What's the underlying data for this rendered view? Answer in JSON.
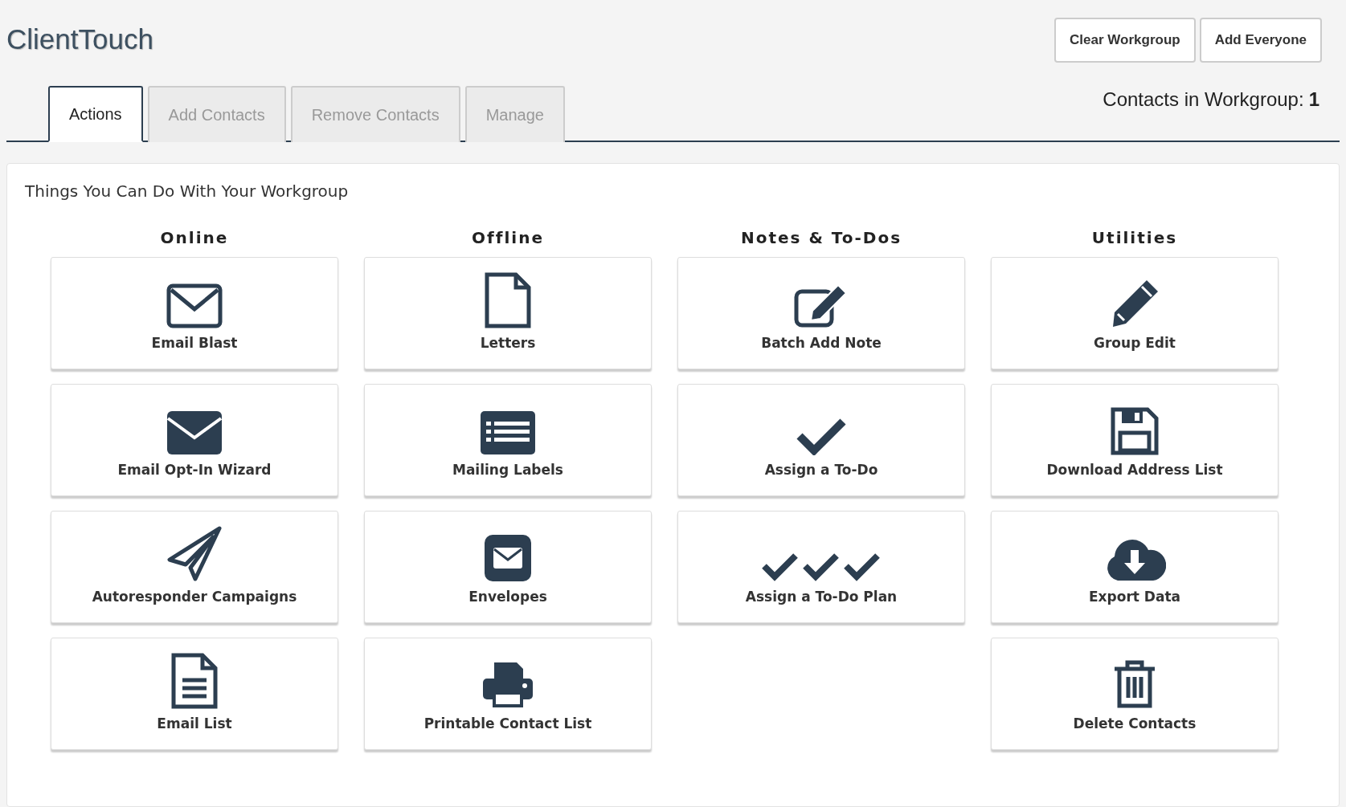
{
  "title": "ClientTouch",
  "header_buttons": [
    "Clear Workgroup",
    "Add Everyone"
  ],
  "tabs": [
    {
      "label": "Actions",
      "selected": true
    },
    {
      "label": "Add Contacts",
      "selected": false
    },
    {
      "label": "Remove Contacts",
      "selected": false
    },
    {
      "label": "Manage",
      "selected": false
    }
  ],
  "workgroup_count": {
    "label": "Contacts in Workgroup:",
    "value": "1"
  },
  "panel": {
    "heading": "Things You Can Do With Your Workgroup",
    "columns": [
      {
        "title": "Online",
        "actions": [
          {
            "label": "Email Blast",
            "kind": "envelope-outline"
          },
          {
            "label": "Email Opt-In Wizard",
            "kind": "envelope-solid"
          },
          {
            "label": "Autoresponder Campaigns",
            "kind": "paper-plane"
          },
          {
            "label": "Email List",
            "kind": "document-lines"
          }
        ]
      },
      {
        "title": "Offline",
        "actions": [
          {
            "label": "Letters",
            "kind": "page"
          },
          {
            "label": "Mailing Labels",
            "kind": "list"
          },
          {
            "label": "Envelopes",
            "kind": "envelope-square"
          },
          {
            "label": "Printable Contact List",
            "kind": "printer"
          }
        ]
      },
      {
        "title": "Notes & To-Dos",
        "actions": [
          {
            "label": "Batch Add Note",
            "kind": "edit"
          },
          {
            "label": "Assign a To-Do",
            "kind": "check"
          },
          {
            "label": "Assign a To-Do Plan",
            "kind": "checks"
          }
        ]
      },
      {
        "title": "Utilities",
        "actions": [
          {
            "label": "Group Edit",
            "kind": "pencil"
          },
          {
            "label": "Download Address List",
            "kind": "floppy"
          },
          {
            "label": "Export Data",
            "kind": "cloud"
          },
          {
            "label": "Delete Contacts",
            "kind": "trash"
          }
        ]
      }
    ]
  }
}
